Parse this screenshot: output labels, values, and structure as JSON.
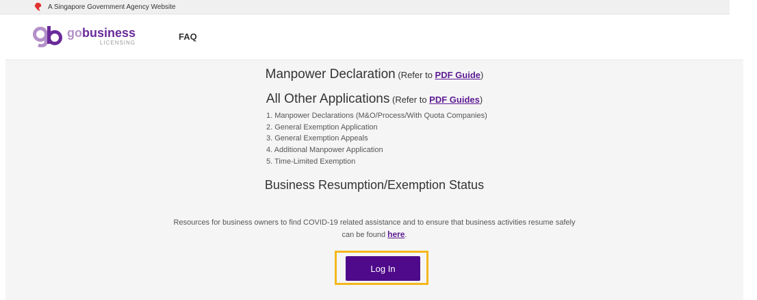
{
  "gov_bar": {
    "text": "A Singapore Government Agency Website",
    "icon": "singapore-lion-icon",
    "icon_color": "#e0332f"
  },
  "header": {
    "logo": {
      "mark": "gb",
      "word_go": "go",
      "word_business": "business",
      "word_licensing": "LICENSING",
      "color_light": "#b390c8",
      "color_dark": "#6a2a9a"
    },
    "nav": {
      "faq": "FAQ"
    }
  },
  "sections": {
    "manpower": {
      "title": "Manpower Declaration",
      "refer_prefix": " (Refer to ",
      "link": "PDF Guide",
      "refer_suffix": ")"
    },
    "other": {
      "title": "All Other Applications",
      "refer_prefix": " (Refer to ",
      "link": "PDF Guides",
      "refer_suffix": ")",
      "items": [
        "1. Manpower Declarations (M&O/Process/With Quota Companies)",
        "2. General Exemption Application",
        "3. General Exemption Appeals",
        "4. Additional Manpower Application",
        "5. Time-Limited Exemption"
      ]
    },
    "status": {
      "title": "Business Resumption/Exemption Status"
    },
    "resources": {
      "line1": "Resources for business owners to find COVID-19 related assistance and to ensure that business activities resume safely",
      "line2_prefix": "can be found ",
      "link": "here",
      "line2_suffix": "."
    }
  },
  "login": {
    "label": "Log In",
    "button_color": "#4e0a8a",
    "highlight_color": "#f4b71c"
  }
}
